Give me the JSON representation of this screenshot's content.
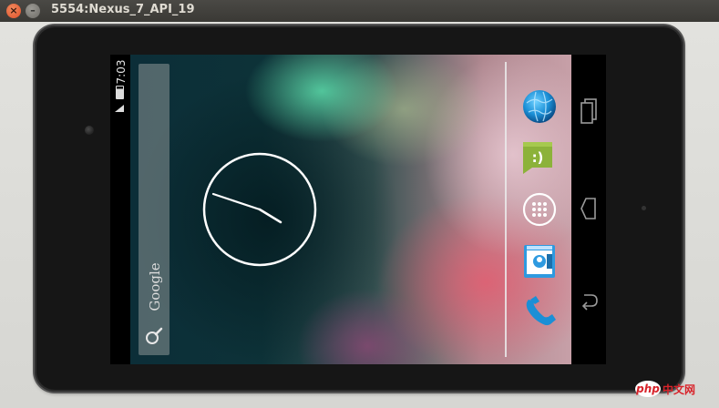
{
  "window": {
    "title": "5554:Nexus_7_API_19",
    "close_glyph": "×",
    "minimize_glyph": "–"
  },
  "status_bar": {
    "time": "7:03",
    "icons": [
      "battery-icon",
      "signal-icon"
    ]
  },
  "search_widget": {
    "logo_text": "Google",
    "icon": "search-icon"
  },
  "clock": {
    "type": "analog",
    "hour": 7,
    "minute": 3
  },
  "dock": {
    "apps": [
      {
        "name": "browser",
        "icon": "globe-icon"
      },
      {
        "name": "messaging",
        "icon": "smiley-message-icon"
      },
      {
        "name": "app-drawer",
        "icon": "app-drawer-icon"
      },
      {
        "name": "contacts",
        "icon": "contacts-icon"
      },
      {
        "name": "phone",
        "icon": "phone-icon"
      }
    ]
  },
  "nav_bar": {
    "buttons": [
      {
        "name": "recent-apps",
        "icon": "recent-apps-icon"
      },
      {
        "name": "home",
        "icon": "home-icon"
      },
      {
        "name": "back",
        "icon": "back-icon"
      }
    ]
  },
  "watermark": {
    "logo": "php",
    "text": "中文网"
  },
  "colors": {
    "accent_blue": "#1b8fd6",
    "message_green": "#8cb23a"
  }
}
